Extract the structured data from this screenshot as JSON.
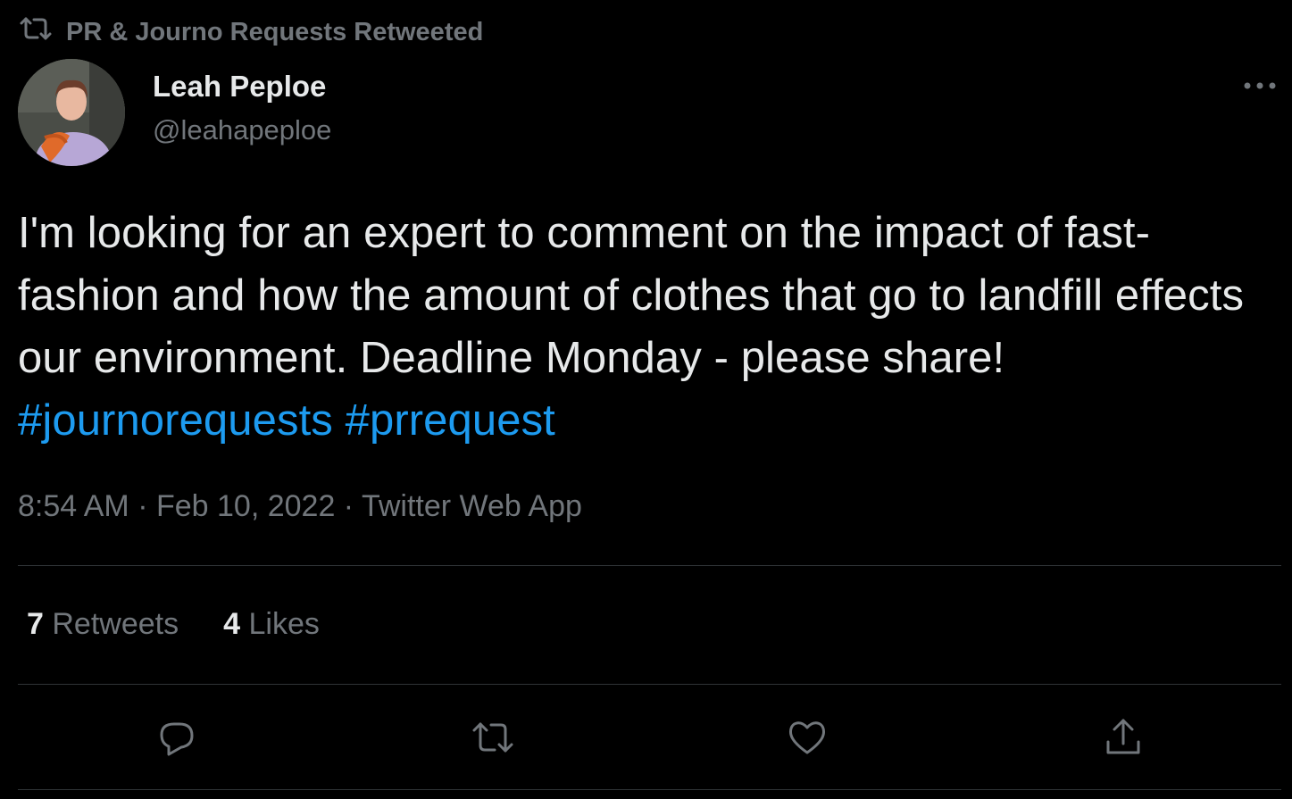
{
  "retweet_context": {
    "text": "PR & Journo Requests Retweeted",
    "icon": "retweet-icon"
  },
  "author": {
    "display_name": "Leah Peploe",
    "handle": "@leahapeploe"
  },
  "tweet": {
    "text": "I'm looking for an expert to comment on the impact of fast-fashion and how the amount of clothes that go to landfill effects our environment. Deadline Monday - please share!",
    "hashtags": [
      "#journorequests",
      "#prrequest"
    ]
  },
  "meta": {
    "time": "8:54 AM",
    "separator": " · ",
    "date": "Feb 10, 2022",
    "source": "Twitter Web App"
  },
  "stats": {
    "retweets_count": "7",
    "retweets_label": "Retweets",
    "likes_count": "4",
    "likes_label": "Likes"
  },
  "actions": [
    "reply-icon",
    "retweet-icon",
    "like-icon",
    "share-icon"
  ],
  "colors": {
    "background": "#000000",
    "text": "#e7e9ea",
    "secondary": "#71767b",
    "accent": "#1d9bf0",
    "divider": "#2f3336"
  }
}
